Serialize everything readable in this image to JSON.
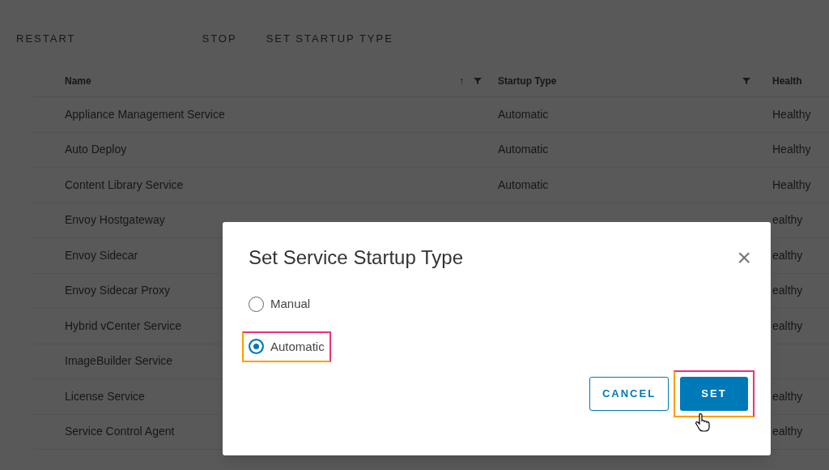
{
  "toolbar": [
    {
      "label": "RESTART"
    },
    {
      "label": "STOP"
    },
    {
      "label": "SET STARTUP TYPE"
    }
  ],
  "table": {
    "columns": [
      {
        "label": "Name",
        "sort": "↑"
      },
      {
        "label": "Startup Type"
      },
      {
        "label": "Health"
      }
    ],
    "rows": [
      {
        "name": "Appliance Management Service",
        "startup": "Automatic",
        "health": "Healthy"
      },
      {
        "name": "Auto Deploy",
        "startup": "Automatic",
        "health": "Healthy"
      },
      {
        "name": "Content Library Service",
        "startup": "Automatic",
        "health": "Healthy"
      },
      {
        "name": "Envoy Hostgateway",
        "health": "ealthy"
      },
      {
        "name": "Envoy Sidecar",
        "health": "ealthy"
      },
      {
        "name": "Envoy Sidecar Proxy",
        "health": "ealthy"
      },
      {
        "name": "Hybrid vCenter Service",
        "health": "ealthy"
      },
      {
        "name": "ImageBuilder Service"
      },
      {
        "name": "License Service",
        "health": "ealthy"
      },
      {
        "name": "Service Control Agent",
        "health": "ealthy"
      }
    ]
  },
  "dialog": {
    "title": "Set Service Startup Type",
    "close": "×",
    "options": [
      {
        "label": "Manual",
        "selected": false,
        "highlighted": false
      },
      {
        "label": "Automatic",
        "selected": true,
        "highlighted": true
      }
    ],
    "buttons": [
      {
        "label": "CANCEL",
        "kind": "secondary",
        "highlighted": false
      },
      {
        "label": "SET",
        "kind": "primary",
        "highlighted": true
      }
    ]
  }
}
